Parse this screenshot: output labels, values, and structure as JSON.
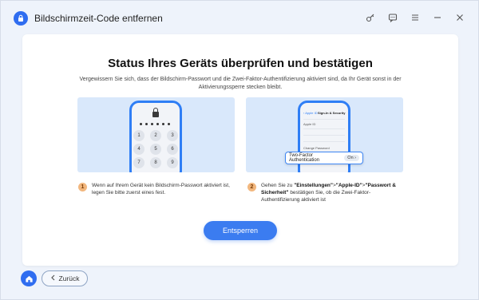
{
  "app": {
    "title": "Bildschirmzeit-Code entfernen"
  },
  "titlebar": {
    "icons": [
      "key-icon",
      "feedback-icon",
      "menu-icon",
      "minimize-icon",
      "close-icon"
    ]
  },
  "main": {
    "heading": "Status Ihres Geräts überprüfen und bestätigen",
    "subtext": "Vergewissern Sie sich, dass der Bildschirm-Passwort und die Zwei-Faktor-Authentifizierung aktiviert sind, da Ihr Gerät sonst in der Aktivierungssperre stecken bleibt.",
    "keypad": [
      "1",
      "2",
      "3",
      "4",
      "5",
      "6",
      "7",
      "8",
      "9"
    ],
    "settings_header": "Sign-In & Security",
    "settings_back": "Apple ID",
    "settings_rows": [
      "Apple ID",
      "",
      "Change Password"
    ],
    "twofa_label": "Two-Factor Authentication",
    "twofa_value": "On",
    "step1": {
      "number": "1",
      "text": "Wenn auf Ihrem Gerät kein Bildschirm-Passwort aktiviert ist, legen Sie bitte zuerst eines fest."
    },
    "step2": {
      "number": "2",
      "prefix": "Gehen Sie zu ",
      "b1": "\"Einstellungen\"",
      "sep1": ">",
      "b2": "\"Apple-ID\"",
      "sep2": ">",
      "b3": "\"Passwort & Sicherheit\"",
      "suffix": " bestätigen Sie, ob die Zwei-Faktor-Authentifizierung aktiviert ist"
    },
    "unlock_label": "Entsperren"
  },
  "footer": {
    "back_label": "Zurück"
  },
  "colors": {
    "accent": "#3b7cf0",
    "step_badge": "#f2b77e",
    "panel_bg": "#d9e8fb",
    "window_bg": "#eef3fb"
  }
}
